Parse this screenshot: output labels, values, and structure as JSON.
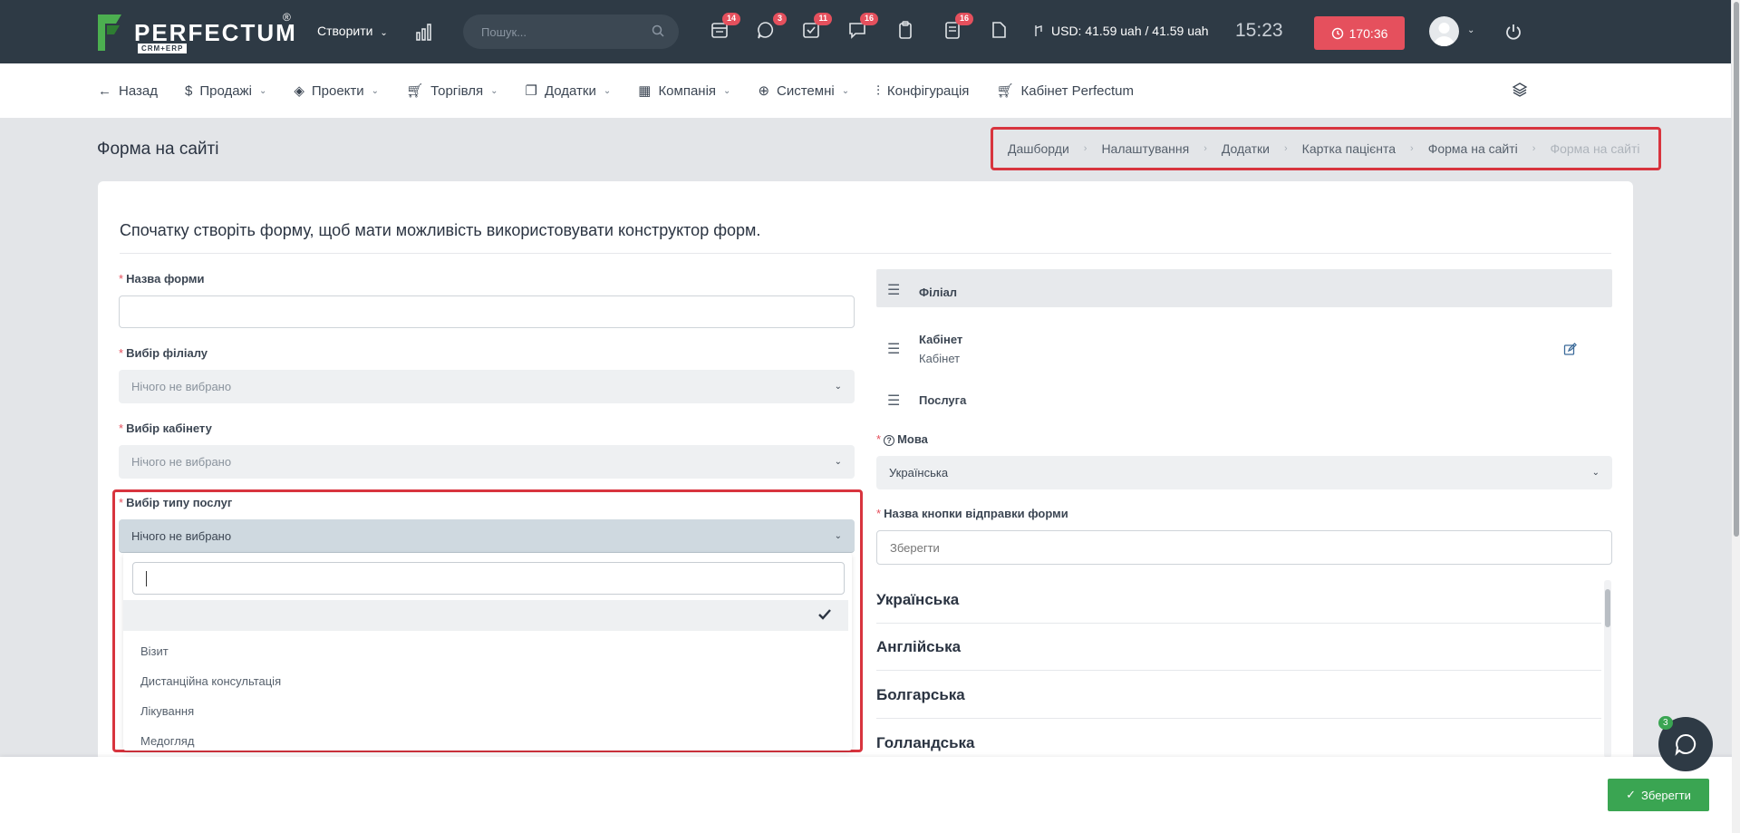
{
  "topbar": {
    "logo_text": "PERFECTUM",
    "logo_sub": "CRM+ERP",
    "logo_reg": "®",
    "create_label": "Створити",
    "search_placeholder": "Пошук...",
    "badges": [
      "14",
      "3",
      "11",
      "16",
      "16"
    ],
    "currency": "USD: 41.59 uah / 41.59 uah",
    "clock": "15:23",
    "timer": "170:36"
  },
  "subnav": {
    "back": "Назад",
    "items": [
      "Продажі",
      "Проекти",
      "Торгівля",
      "Додатки",
      "Компанія",
      "Системні"
    ],
    "config": "Конфігурація",
    "cabinet": "Кабінет Perfectum"
  },
  "page": {
    "title": "Форма на сайті",
    "breadcrumb": [
      "Дашборди",
      "Налаштування",
      "Додатки",
      "Картка пацієнта",
      "Форма на сайті",
      "Форма на сайті"
    ]
  },
  "card": {
    "heading": "Спочатку створіть форму, щоб мати можливість використовувати конструктор форм.",
    "form_name_label": "Назва форми",
    "form_name_value": "",
    "branch_label": "Вибір філіалу",
    "branch_value": "Нічого не вибрано",
    "cabinet_label": "Вибір кабінету",
    "cabinet_value": "Нічого не вибрано",
    "service_label": "Вибір типу послуг",
    "service_value": "Нічого не вибрано",
    "dropdown_options": [
      "",
      "Візит",
      "Дистанційна консультація",
      "Лікування",
      "Медогляд"
    ]
  },
  "right": {
    "filial": "Філіал",
    "cabinet_title": "Кабінет",
    "cabinet_sub": "Кабінет",
    "service": "Послуга",
    "lang_label": "Мова",
    "lang_value": "Українська",
    "submit_label": "Назва кнопки відправки форми",
    "submit_placeholder": "Зберегти",
    "languages": [
      "Українська",
      "Англійська",
      "Болгарська",
      "Голландська"
    ]
  },
  "footer": {
    "save": "Зберегти",
    "chat_badge": "3"
  },
  "colors": {
    "topbar": "#2e3a45",
    "accent_red": "#e5505d",
    "highlight": "#d8343e",
    "save_green": "#3aa552"
  }
}
